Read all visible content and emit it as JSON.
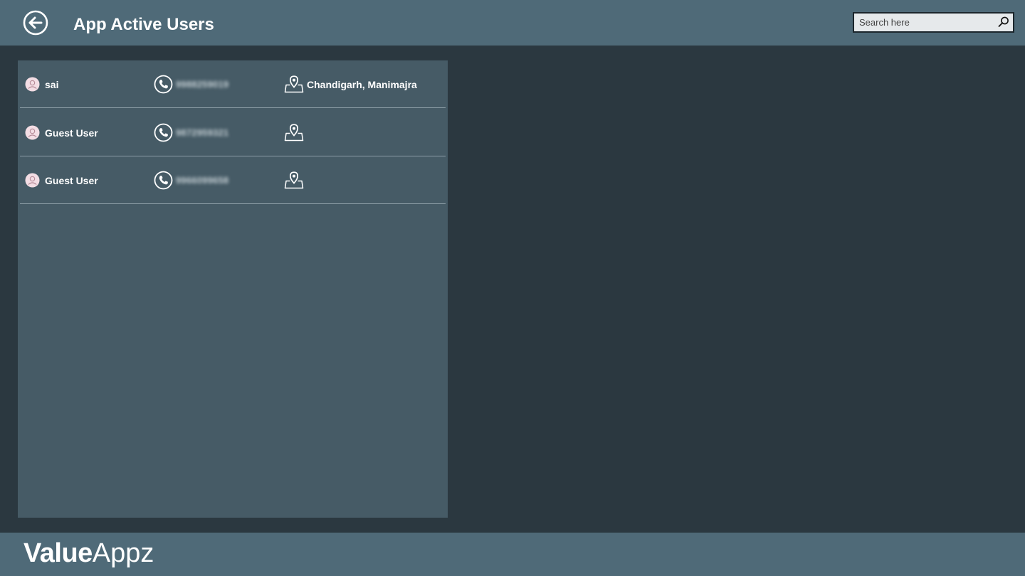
{
  "header": {
    "title": "App Active Users",
    "back_icon": "back-arrow-circle-icon"
  },
  "search": {
    "placeholder": "Search here",
    "value": "",
    "icon": "search-icon"
  },
  "users": [
    {
      "name": "sai",
      "phone": "9988259019",
      "location": "Chandigarh, Manimajra"
    },
    {
      "name": "Guest User",
      "phone": "9872959321",
      "location": ""
    },
    {
      "name": "Guest User",
      "phone": "9966099658",
      "location": ""
    }
  ],
  "footer": {
    "brand_bold": "Value",
    "brand_light": "Appz"
  },
  "colors": {
    "header_bg": "#4f6a78",
    "page_bg": "#2b3840",
    "panel_bg": "#465b66",
    "search_bg": "#e6e9eb"
  }
}
